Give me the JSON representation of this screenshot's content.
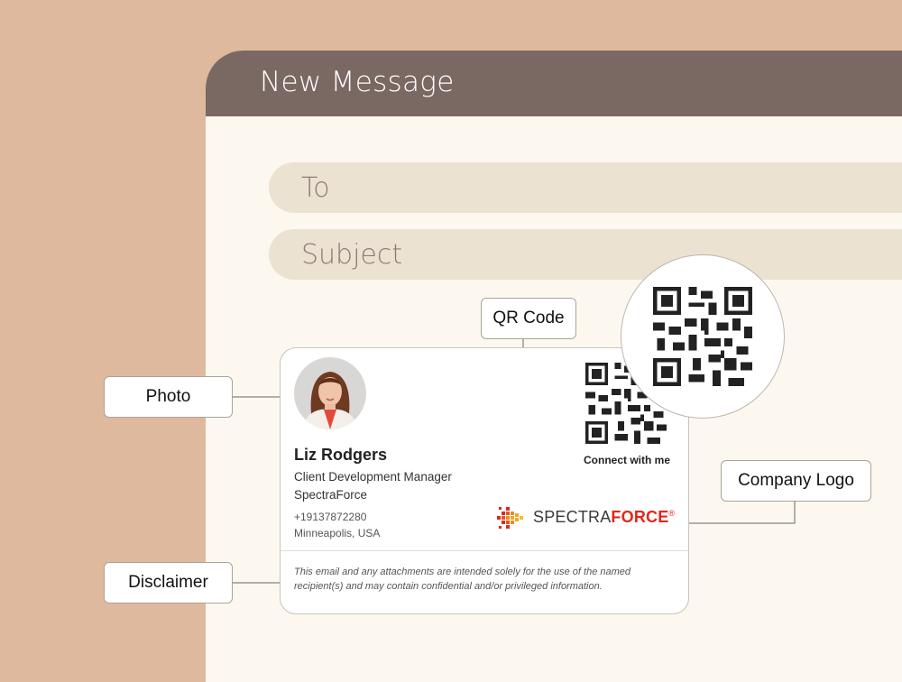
{
  "window": {
    "title": "New Message"
  },
  "fields": {
    "to_placeholder": "To",
    "subject_placeholder": "Subject"
  },
  "signature": {
    "name": "Liz Rodgers",
    "role": "Client Development Manager",
    "company": "SpectraForce",
    "phone": "+19137872280",
    "location": "Minneapolis, USA",
    "qr_caption": "Connect with me",
    "logo": {
      "part1": "SPECTRA",
      "part2": "FORCE",
      "mark": "®"
    },
    "disclaimer": "This email and any attachments are intended solely for the use of the named recipient(s) and may contain confidential and/or privileged information."
  },
  "callouts": {
    "qr_code": "QR Code",
    "photo": "Photo",
    "company_logo": "Company Logo",
    "disclaimer": "Disclaimer"
  },
  "colors": {
    "background": "#dfb99d",
    "titlebar": "#7a6863",
    "window": "#fdf8ef",
    "field": "#ece2d2",
    "brand_red": "#e3261b"
  }
}
